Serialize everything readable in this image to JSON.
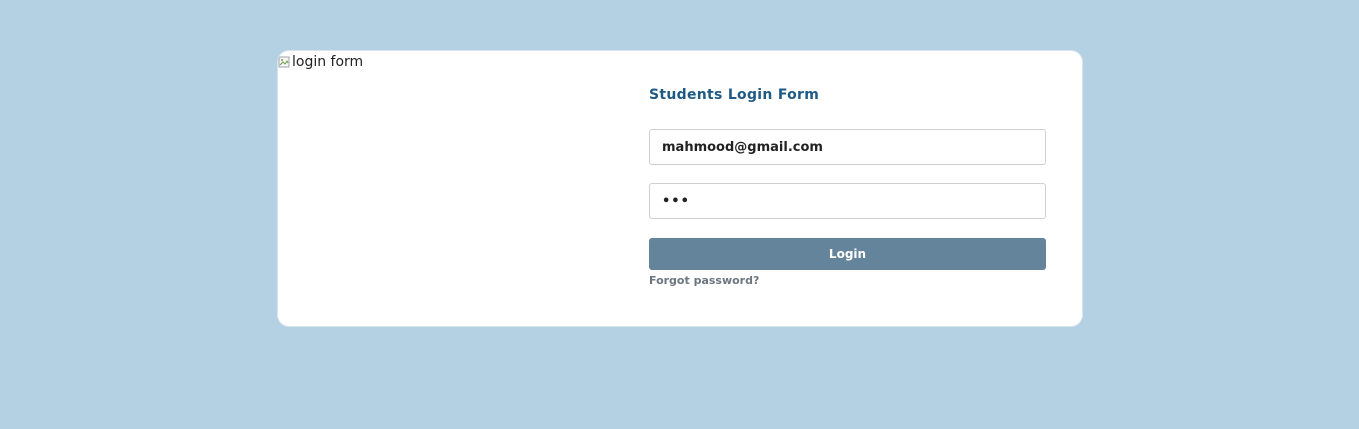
{
  "login": {
    "image_alt": "login form",
    "title": "Students Login Form",
    "email_value": "mahmood@gmail.com",
    "password_masked": "•••",
    "login_label": "Login",
    "forgot_password_label": "Forgot password?"
  }
}
